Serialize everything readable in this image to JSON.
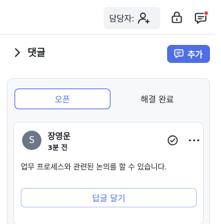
{
  "topbar": {
    "assignee_label": "담당자:",
    "icons": [
      "add-person-icon",
      "lock-icon",
      "comment-alert-icon"
    ],
    "alert_dot_color": "#f53f3f"
  },
  "comments": {
    "title": "댓글",
    "add_label": "추가",
    "accent_color": "#4e6ee6"
  },
  "tabs": [
    {
      "label": "오픈",
      "active": true
    },
    {
      "label": "해결 완료",
      "active": false
    }
  ],
  "comment": {
    "avatar_initial": "S",
    "author": "장영운",
    "time": "3분 전",
    "body": "업무 프로세스와 관련된 논의를 할 수 있습니다.",
    "reply_label": "답글 달기"
  }
}
